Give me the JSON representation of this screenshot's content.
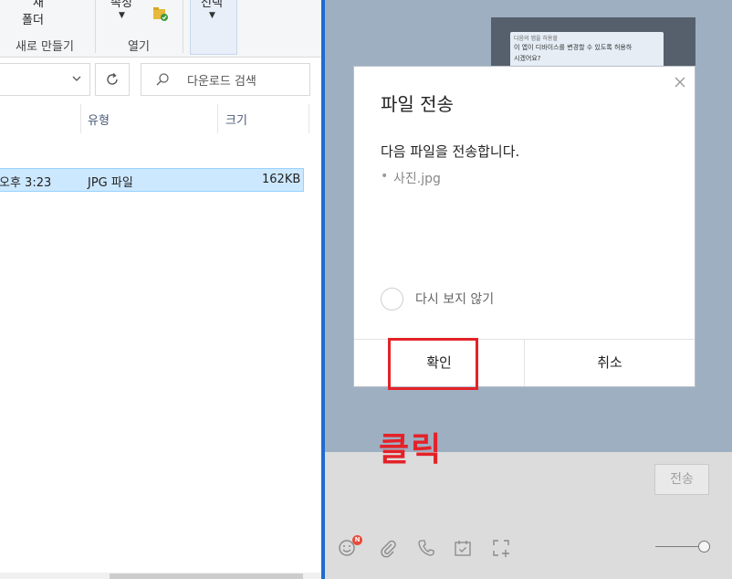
{
  "explorer": {
    "ribbon": {
      "new_folder_line1": "새",
      "new_folder_line2": "폴더",
      "new_group": "새로 만들기",
      "properties_partial": "속성",
      "open_group": "열기",
      "select_partial": "선택"
    },
    "search": {
      "placeholder": "다운로드 검색"
    },
    "columns": {
      "type": "유형",
      "size": "크기"
    },
    "row": {
      "date": "오후 3:23",
      "type": "JPG 파일",
      "size": "162KB"
    }
  },
  "chat": {
    "image_preview": {
      "small_text": "다음의 앱을 허용할",
      "line1": "이 앱이 디바이스를 변경할 수 있도록 허용하",
      "line2": "시겠어요?"
    },
    "send_label": "전송",
    "emoji_badge": "N",
    "toolbar_icons": [
      "emoji-icon",
      "paperclip-icon",
      "phone-icon",
      "calendar-icon",
      "capture-icon"
    ]
  },
  "dialog": {
    "title": "파일 전송",
    "message": "다음 파일을 전송합니다.",
    "bullet": "•",
    "file_name": "사진.jpg",
    "dont_show_again": "다시 보지 않기",
    "confirm_label": "확인",
    "cancel_label": "취소"
  },
  "annotation": {
    "text": "클릭",
    "color": "#e32228"
  },
  "colors": {
    "accent_blue": "#1f6bd1",
    "chat_bg": "#9eafc2",
    "selection": "#cce8ff"
  }
}
